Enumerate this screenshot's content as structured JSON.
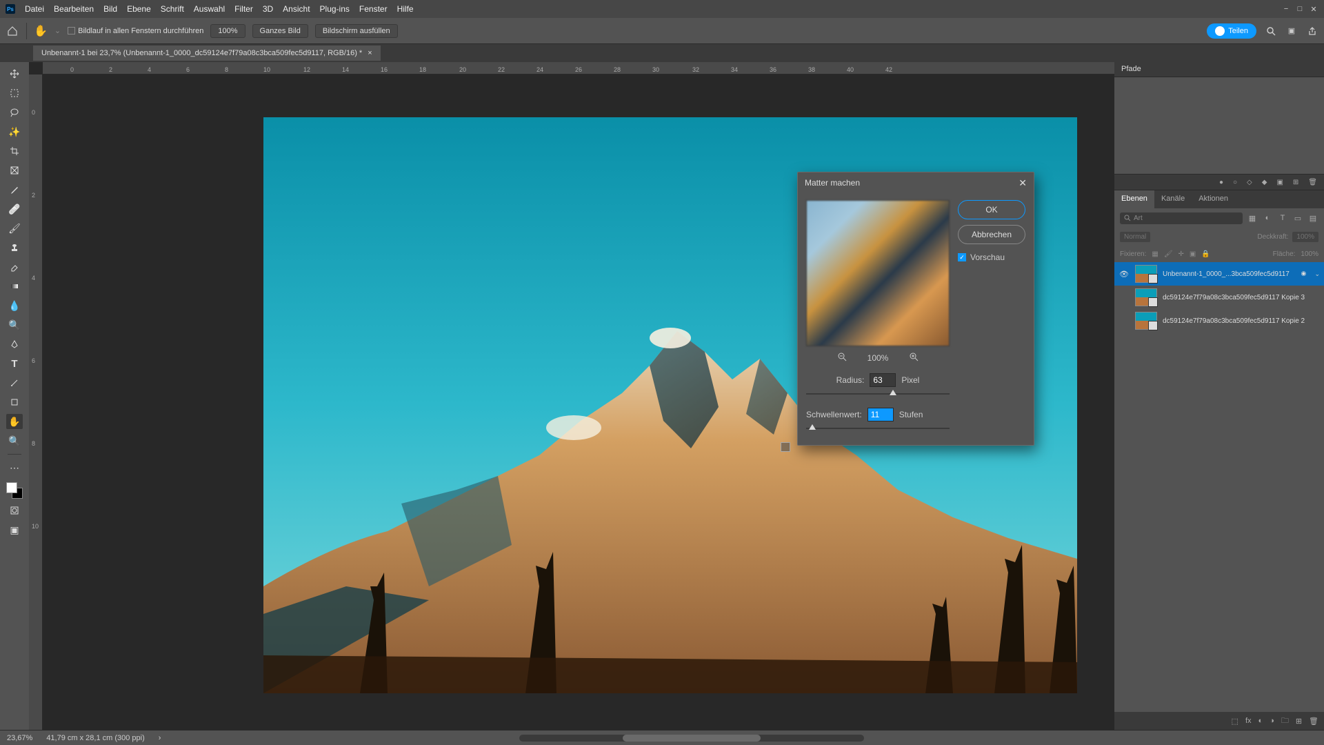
{
  "menubar": {
    "items": [
      "Datei",
      "Bearbeiten",
      "Bild",
      "Ebene",
      "Schrift",
      "Auswahl",
      "Filter",
      "3D",
      "Ansicht",
      "Plug-ins",
      "Fenster",
      "Hilfe"
    ]
  },
  "optbar": {
    "scroll_all": "Bildlauf in allen Fenstern durchführen",
    "zoom100": "100%",
    "fit": "Ganzes Bild",
    "fill": "Bildschirm ausfüllen",
    "share": "Teilen"
  },
  "doctab": {
    "title": "Unbenannt-1 bei 23,7% (Unbenannt-1_0000_dc59124e7f79a08c3bca509fec5d9117, RGB/16) *"
  },
  "ruler_h": [
    "0",
    "2",
    "4",
    "6",
    "8",
    "10",
    "12",
    "14",
    "16",
    "18",
    "20",
    "22",
    "24",
    "26",
    "28",
    "30",
    "32",
    "34",
    "36",
    "38",
    "40",
    "42"
  ],
  "ruler_v": [
    "0",
    "2",
    "4",
    "6",
    "8",
    "10"
  ],
  "dialog": {
    "title": "Matter machen",
    "ok": "OK",
    "cancel": "Abbrechen",
    "preview_label": "Vorschau",
    "zoom": "100%",
    "radius_label": "Radius:",
    "radius_value": "63",
    "radius_unit": "Pixel",
    "threshold_label": "Schwellenwert:",
    "threshold_value": "11",
    "threshold_unit": "Stufen"
  },
  "rightpanel": {
    "pfade": "Pfade",
    "tabs": [
      "Ebenen",
      "Kanäle",
      "Aktionen"
    ],
    "search_placeholder": "Art",
    "blend_mode": "Normal",
    "opacity_label": "Deckkraft:",
    "opacity_value": "100%",
    "lock_label": "Fixieren:",
    "fill_label": "Fläche:",
    "fill_value": "100%",
    "layers": [
      {
        "name": "Unbenannt-1_0000_...3bca509fec5d9117",
        "visible": true,
        "active": true
      },
      {
        "name": "dc59124e7f79a08c3bca509fec5d9117 Kopie 3",
        "visible": false,
        "active": false
      },
      {
        "name": "dc59124e7f79a08c3bca509fec5d9117 Kopie 2",
        "visible": false,
        "active": false
      }
    ]
  },
  "status": {
    "zoom": "23,67%",
    "dims": "41,79 cm x 28,1 cm (300 ppi)"
  }
}
